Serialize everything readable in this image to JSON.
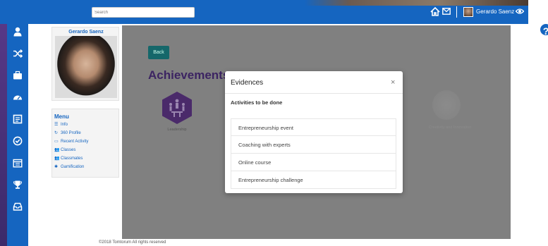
{
  "header": {
    "search_placeholder": "Search",
    "user_name": "Gerardo Saenz"
  },
  "profile": {
    "name": "Gerardo Saenz"
  },
  "menu": {
    "title": "Menu",
    "items": [
      {
        "label": "Info",
        "icon": "list-icon"
      },
      {
        "label": "360 Profile",
        "icon": "refresh-icon"
      },
      {
        "label": "Recent Activity",
        "icon": "chat-icon"
      },
      {
        "label": "Classes",
        "icon": "users-icon"
      },
      {
        "label": "Classmates",
        "icon": "users-icon"
      },
      {
        "label": "Gamification",
        "icon": "gamepad-icon"
      }
    ]
  },
  "main": {
    "back_label": "Back",
    "title": "Achievements",
    "badges": [
      {
        "label": "Leadership"
      },
      {
        "label": "Creativity and Innovation"
      }
    ]
  },
  "modal": {
    "title": "Evidences",
    "close": "×",
    "subtitle": "Activities to be done",
    "items": [
      "Entrepreneurship event",
      "Coaching with experts",
      "Online course",
      "Entrepreneurship challenge"
    ]
  },
  "help_label": "?",
  "footer": "©2018 Tomtorum All rights reserved",
  "colors": {
    "topbar": "#1565c0",
    "overlay": "#808080",
    "accent_purple": "#3c2462",
    "back_button": "#15676a"
  }
}
